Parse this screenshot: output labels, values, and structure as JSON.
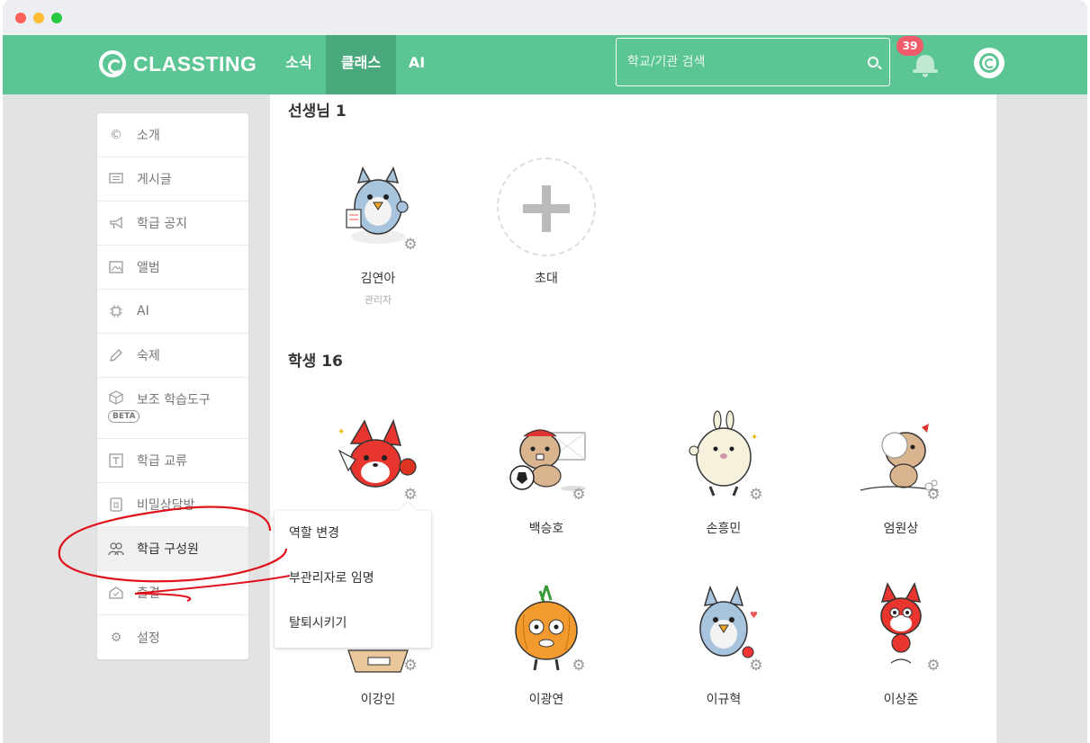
{
  "nav": {
    "logo": "CLASSTING",
    "tabs": [
      {
        "label": "소식"
      },
      {
        "label": "클래스"
      },
      {
        "label": "AI"
      }
    ],
    "search_placeholder": "학교/기관 검색",
    "notification_count": "39"
  },
  "sidebar": {
    "items": [
      {
        "label": "소개"
      },
      {
        "label": "게시글"
      },
      {
        "label": "학급 공지"
      },
      {
        "label": "앨범"
      },
      {
        "label": "AI"
      },
      {
        "label": "숙제"
      },
      {
        "label": "보조 학습도구",
        "badge": "BETA"
      },
      {
        "label": "학급 교류"
      },
      {
        "label": "비밀상담방"
      },
      {
        "label": "학급 구성원"
      },
      {
        "label": "출결"
      },
      {
        "label": "설정"
      }
    ]
  },
  "teachers": {
    "title": "선생님 1",
    "members": [
      {
        "name": "김연아",
        "role": "관리자"
      }
    ],
    "invite_label": "초대"
  },
  "students": {
    "title": "학생 16",
    "members": [
      {
        "name": ""
      },
      {
        "name": "백승호"
      },
      {
        "name": "손흥민"
      },
      {
        "name": "엄원상"
      },
      {
        "name": "이강인"
      },
      {
        "name": "이광연"
      },
      {
        "name": "이규혁"
      },
      {
        "name": "이상준"
      }
    ]
  },
  "context_menu": {
    "items": [
      {
        "label": "역할 변경"
      },
      {
        "label": "부관리자로 임명"
      },
      {
        "label": "탈퇴시키기"
      }
    ]
  },
  "colors": {
    "brand_green": "#5cc594",
    "active_tab": "#4aa97c",
    "badge_red": "#f05b6b",
    "annotation_red": "#e0131c"
  }
}
